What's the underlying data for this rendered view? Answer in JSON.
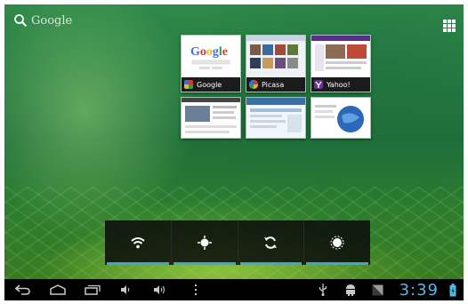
{
  "search": {
    "label": "Google"
  },
  "tiles": [
    {
      "title": "Google"
    },
    {
      "title": "Picasa"
    },
    {
      "title": "Yahoo!"
    }
  ],
  "status": {
    "time": "3:39"
  },
  "colors": {
    "accent": "#3ea6d6",
    "navbar": "#000000",
    "caption": "#1b1b1b"
  },
  "icons": {
    "quick_settings": [
      "wifi-icon",
      "gps-icon",
      "sync-icon",
      "brightness-icon"
    ],
    "nav": [
      "back-icon",
      "home-icon",
      "recent-apps-icon",
      "volume-down-icon",
      "volume-up-icon",
      "menu-icon"
    ],
    "status": [
      "usb-icon",
      "android-debug-icon",
      "signal-icon",
      "battery-icon"
    ]
  }
}
